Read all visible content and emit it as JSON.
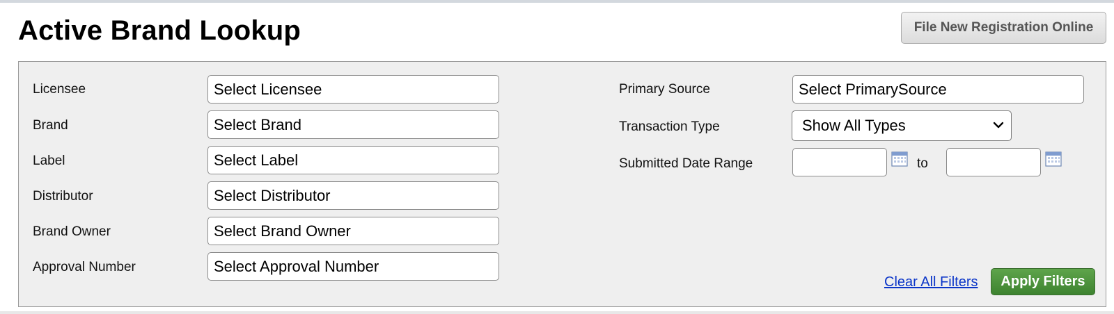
{
  "page": {
    "title": "Active Brand Lookup",
    "file_new_button": "File New Registration Online"
  },
  "filters": {
    "left": [
      {
        "label": "Licensee",
        "placeholder": "Select Licensee"
      },
      {
        "label": "Brand",
        "placeholder": "Select Brand"
      },
      {
        "label": "Label",
        "placeholder": "Select Label"
      },
      {
        "label": "Distributor",
        "placeholder": "Select Distributor"
      },
      {
        "label": "Brand Owner",
        "placeholder": "Select Brand Owner"
      },
      {
        "label": "Approval Number",
        "placeholder": "Select Approval Number"
      }
    ],
    "primary_source": {
      "label": "Primary Source",
      "placeholder": "Select PrimarySource"
    },
    "transaction_type": {
      "label": "Transaction Type",
      "selected": "Show All Types"
    },
    "date_range": {
      "label": "Submitted Date Range",
      "separator": "to",
      "from_value": "",
      "to_value": ""
    }
  },
  "actions": {
    "clear_label": "Clear All Filters",
    "apply_label": "Apply Filters"
  },
  "colors": {
    "panel_bg": "#efefef",
    "apply_green": "#4a9438",
    "link_blue": "#0b35c8"
  },
  "icons": {
    "calendar": "calendar-icon",
    "dropdown": "chevron-down-icon"
  }
}
